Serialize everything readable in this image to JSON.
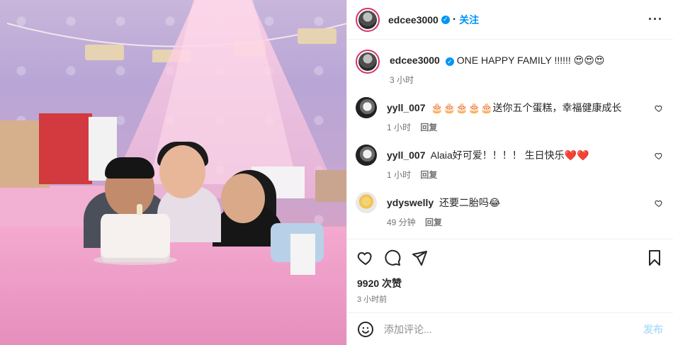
{
  "header": {
    "username": "edcee3000",
    "follow_label": "关注",
    "more_label": "···"
  },
  "caption": {
    "username": "edcee3000",
    "text": "ONE HAPPY FAMILY !!!!!! 😍😍😍",
    "time": "3 小时"
  },
  "comments": [
    {
      "username": "yyll_007",
      "text": "🎂🎂🎂🎂🎂送你五个蛋糕，幸福健康成长",
      "time": "1 小时",
      "reply": "回复"
    },
    {
      "username": "yyll_007",
      "text": "Alaia好可爱！！！！ 生日快乐❤️❤️",
      "time": "1 小时",
      "reply": "回复"
    },
    {
      "username": "ydyswelly",
      "text": "还要二胎吗😂",
      "time": "49 分钟",
      "reply": "回复"
    }
  ],
  "footer": {
    "likes": "9920 次赞",
    "time": "3 小时前",
    "comment_placeholder": "添加评论...",
    "post_label": "发布"
  },
  "colors": {
    "accent": "#0095f6",
    "muted": "#737373",
    "post_disabled": "#b2dffc",
    "heart_red": "#e0245e"
  },
  "icons": [
    "verified-icon",
    "more-icon",
    "heart-icon",
    "comment-icon",
    "share-icon",
    "bookmark-icon",
    "emoji-icon"
  ]
}
